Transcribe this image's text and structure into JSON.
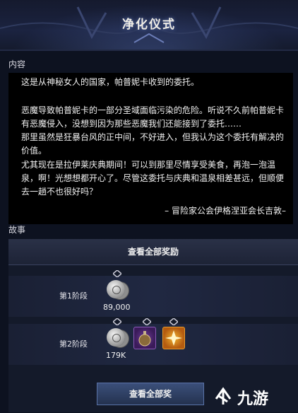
{
  "header": {
    "title": "净化仪式"
  },
  "content": {
    "label": "内容",
    "paragraphs": [
      "这是从神秘女人的国家，帕普妮卡收到的委托。",
      "恶魔导致帕普妮卡的一部分圣域面临污染的危险。听说不久前帕普妮卡",
      "有恶魔侵入，没想到因为那些恶魔我们还能接到了委托……",
      "那里虽然是狂暴台风的正中间，不好进入，但我认为这个委托有解决的",
      "价值。",
      "尤其现在是拉伊莱庆典期间！可以到那里尽情享受美食，再泡一泡温",
      "泉，啊！光想想都开心了。尽管这委托与庆典和温泉相差甚远，但顺便",
      "去一趟不也很好吗？"
    ],
    "signature": "– 冒险家公会伊格涅亚会长吉敦–"
  },
  "story": {
    "label": "故事",
    "all_rewards_button": "查看全部奖励",
    "stages": [
      {
        "label": "第1阶段",
        "amount": "89,000",
        "items": [
          "silver-coin"
        ]
      },
      {
        "label": "第2阶段",
        "amount": "179K",
        "items": [
          "silver-coin",
          "potion-bottle",
          "sparkle-card"
        ]
      }
    ]
  },
  "bottom_button": "查看全部奖",
  "watermark": {
    "text": "九游"
  },
  "colors": {
    "background": "#0d1220",
    "content_bg": "#000000",
    "panel": "#141a2a",
    "accent": "#5a73a8"
  }
}
